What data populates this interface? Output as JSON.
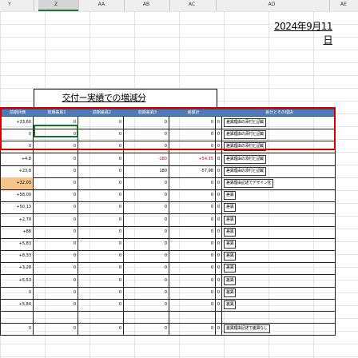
{
  "sheet": {
    "columns": [
      "Y",
      "Z",
      "AA",
      "AB",
      "AC",
      "AD",
      "AE"
    ],
    "selected_column": "Z",
    "date": "2024年9月11日",
    "section_title": "交付ー実績での増減分",
    "headers": [
      "前期評価",
      "前期差異1",
      "前期差異2",
      "前期差異3",
      "差額計",
      "",
      "差分とその理由"
    ],
    "rows": [
      {
        "a": "+33,60",
        "b": "0",
        "c": "0",
        "d": "0",
        "e": "0",
        "f": "0",
        "comment": "差異理由の添付と記載"
      },
      {
        "a": "0",
        "b": "0",
        "c": "0",
        "d": "0",
        "e": "0",
        "f": "0",
        "comment": "差異理由の添付と記載"
      },
      {
        "a": "0",
        "b": "0",
        "c": "0",
        "d": "0",
        "e": "0",
        "f": "0",
        "comment": "差異理由の添付と記載"
      },
      {
        "a": "+4,8",
        "b": "0",
        "c": "0",
        "d": "-180",
        "e": "+54,35",
        "f": "0",
        "comment": "差異理由の添付と記載"
      },
      {
        "a": "+23,8",
        "b": "0",
        "c": "0",
        "d": "180",
        "e": "-57,98",
        "f": "0",
        "comment": "差異理由の添付と記載"
      },
      {
        "a": "+32,03",
        "b": "0",
        "c": "0",
        "d": "0",
        "e": "0",
        "f": "0",
        "comment": "差異理由記述でデザインを"
      },
      {
        "a": "+58,00",
        "b": "0",
        "c": "0",
        "d": "0",
        "e": "0",
        "f": "0",
        "comment": "差異"
      },
      {
        "a": "+50,13",
        "b": "0",
        "c": "0",
        "d": "0",
        "e": "0",
        "f": "0",
        "comment": "差異"
      },
      {
        "a": "+2,78",
        "b": "0",
        "c": "0",
        "d": "0",
        "e": "0",
        "f": "0",
        "comment": "差異"
      },
      {
        "a": "+88",
        "b": "0",
        "c": "0",
        "d": "0",
        "e": "0",
        "f": "0",
        "comment": "差異"
      },
      {
        "a": "+5,83",
        "b": "0",
        "c": "0",
        "d": "0",
        "e": "0",
        "f": "0",
        "comment": "差異"
      },
      {
        "a": "+8,33",
        "b": "0",
        "c": "0",
        "d": "0",
        "e": "0",
        "f": "0",
        "comment": "差異"
      },
      {
        "a": "+3,28",
        "b": "0",
        "c": "0",
        "d": "0",
        "e": "0",
        "f": "0",
        "comment": "差異"
      },
      {
        "a": "+5,53",
        "b": "0",
        "c": "0",
        "d": "0",
        "e": "0",
        "f": "0",
        "comment": "差異"
      },
      {
        "a": "0",
        "b": "0",
        "c": "0",
        "d": "0",
        "e": "0",
        "f": "0",
        "comment": "差異"
      },
      {
        "a": "+5,84",
        "b": "0",
        "c": "0",
        "d": "0",
        "e": "0",
        "f": "0",
        "comment": "差異"
      },
      {
        "a": "",
        "b": "",
        "c": "",
        "d": "",
        "e": "",
        "f": "",
        "comment": ""
      },
      {
        "a": "0",
        "b": "0",
        "c": "0",
        "d": "0",
        "e": "0",
        "f": "0",
        "comment": "差異理由記述で差異なし"
      }
    ]
  },
  "colors": {
    "header_bg": "#4f7bb5",
    "highlight": "#f4c48a",
    "frame_red": "#d00000",
    "excel_green": "#217346"
  }
}
